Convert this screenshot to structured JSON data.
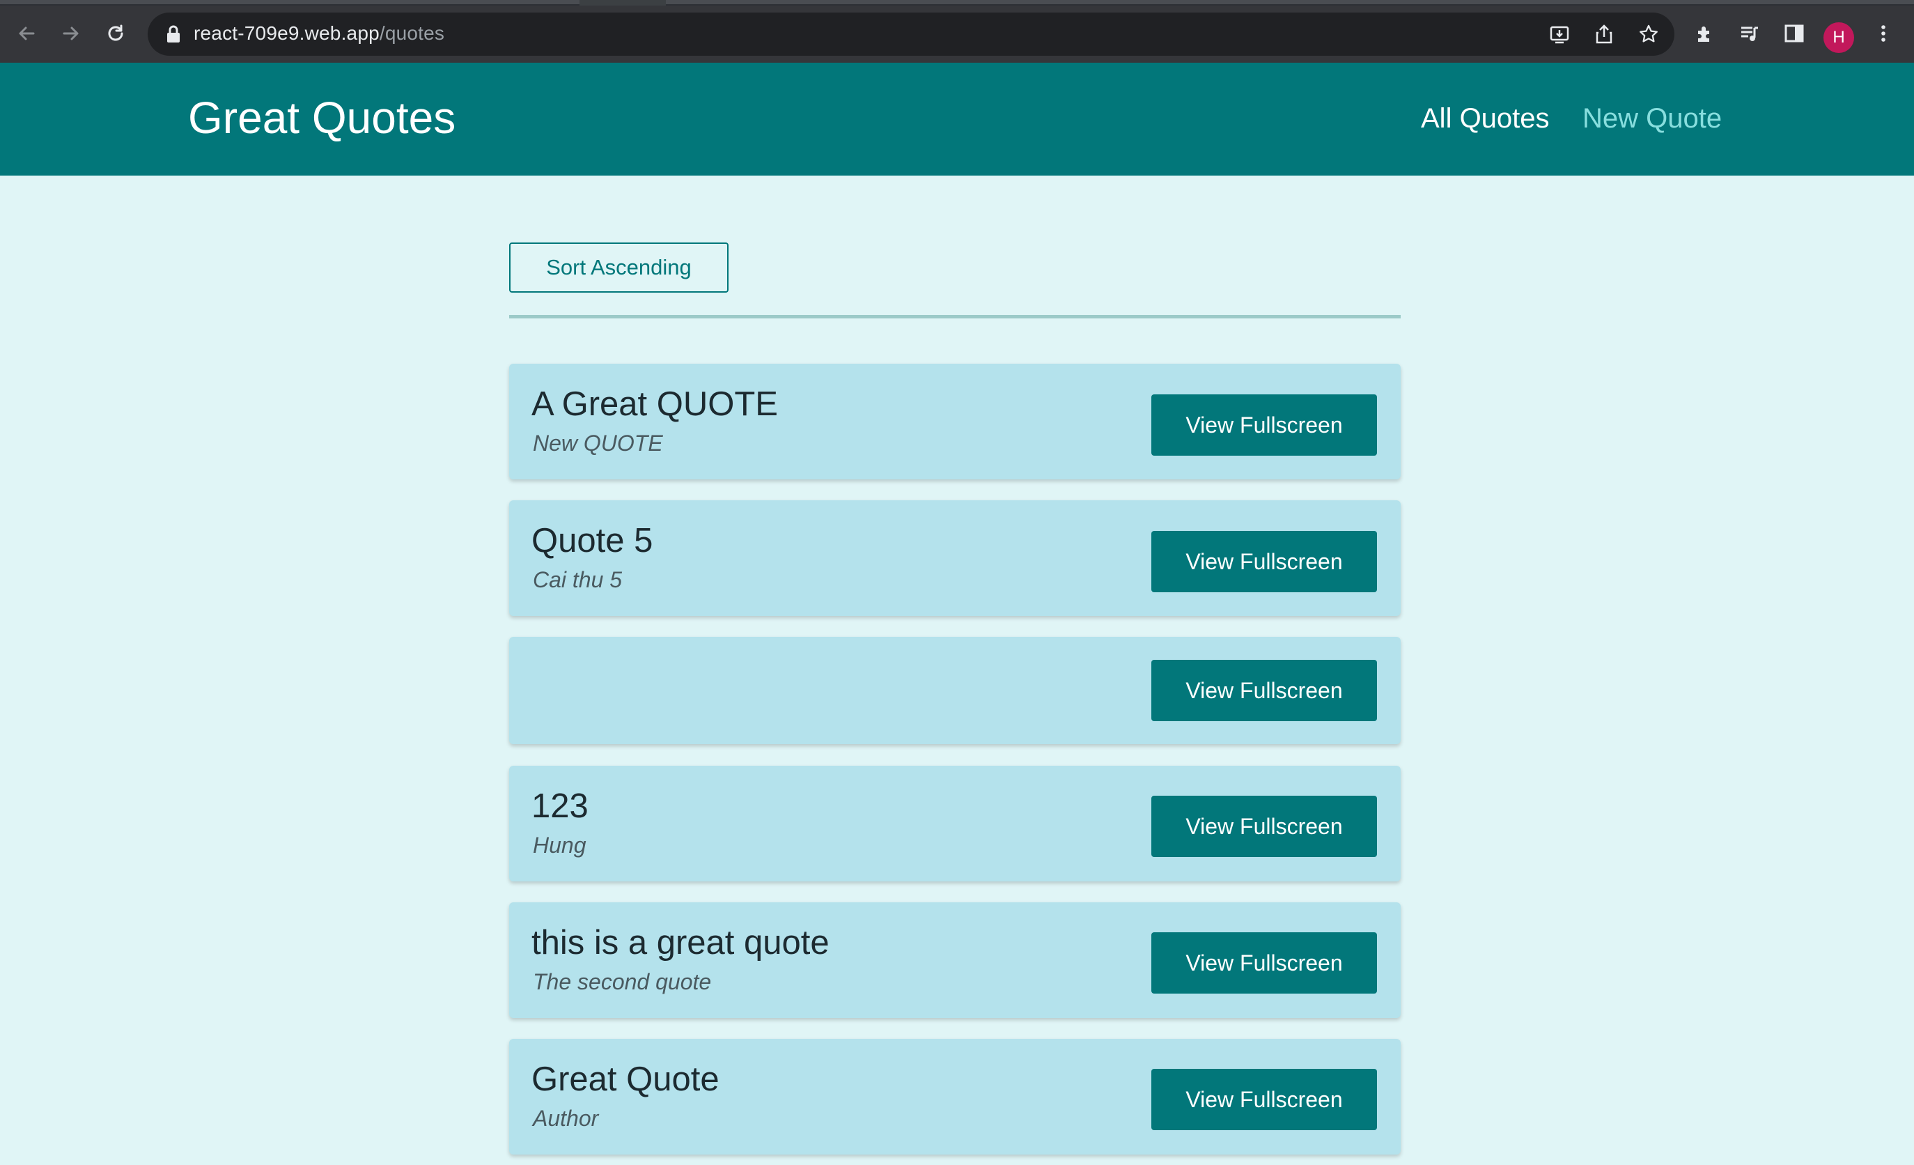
{
  "browser": {
    "url_host": "react-709e9.web.app",
    "url_path": "/quotes",
    "profile_initial": "H",
    "icons": [
      "back-arrow-icon",
      "forward-arrow-icon",
      "reload-icon",
      "lock-icon",
      "install-icon",
      "share-icon",
      "star-icon",
      "extensions-icon",
      "media-icon",
      "sidepanel-icon",
      "menu-icon"
    ],
    "colors": {
      "toolbar": "#35363a",
      "urlbar": "#202124",
      "avatar": "#c2185b"
    }
  },
  "header": {
    "title": "Great Quotes",
    "nav": {
      "all_quotes": "All Quotes",
      "new_quote": "New Quote"
    },
    "colors": {
      "background": "#02777a",
      "active_link": "#88dede"
    }
  },
  "main": {
    "sort_label": "Sort Ascending",
    "view_label": "View Fullscreen",
    "quotes": [
      {
        "text": "A Great QUOTE",
        "author": "New QUOTE"
      },
      {
        "text": "Quote 5",
        "author": "Cai thu 5"
      },
      {
        "text": "",
        "author": ""
      },
      {
        "text": "123",
        "author": "Hung"
      },
      {
        "text": "this is a great quote",
        "author": "The second quote"
      },
      {
        "text": "Great Quote",
        "author": "Author"
      }
    ],
    "colors": {
      "page_bg": "#e0f5f6",
      "card_bg": "#b4e2ec",
      "accent": "#02777a"
    }
  }
}
